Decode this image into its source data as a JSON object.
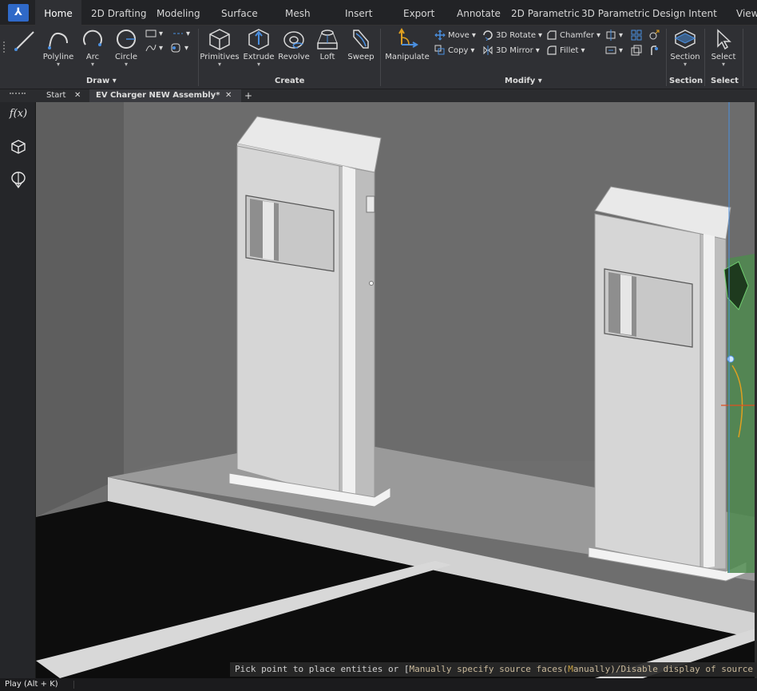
{
  "app": {
    "logo": "⅄"
  },
  "menu": {
    "tabs": [
      "Home",
      "2D Drafting",
      "Modeling",
      "Surface",
      "Mesh",
      "Insert",
      "Export",
      "Annotate",
      "2D Parametric",
      "3D Parametric",
      "Design Intent",
      "View"
    ],
    "active": "Home"
  },
  "ribbon": {
    "draw": {
      "polyline": "Polyline",
      "arc": "Arc",
      "circle": "Circle",
      "group": "Draw"
    },
    "create": {
      "primitives": "Primitives",
      "extrude": "Extrude",
      "revolve": "Revolve",
      "loft": "Loft",
      "sweep": "Sweep",
      "group": "Create"
    },
    "modify": {
      "manipulate": "Manipulate",
      "move": "Move",
      "rotate3d": "3D Rotate",
      "chamfer": "Chamfer",
      "copy": "Copy",
      "mirror3d": "3D Mirror",
      "fillet": "Fillet",
      "group": "Modify"
    },
    "section": {
      "label": "Section",
      "group": "Section"
    },
    "select": {
      "label": "Select",
      "group": "Select"
    }
  },
  "doc_tabs": {
    "start": "Start",
    "active": "EV Charger NEW Assembly*",
    "close": "✕",
    "add": "+"
  },
  "leftbar": {
    "fx": "f(x)"
  },
  "command_line": {
    "prefix": "Pick point to place entities or [",
    "opt1_pre": "M",
    "opt1_rest": "anually specify source faces(",
    "opt1_key": "M",
    "opt1_end": "anually)/",
    "opt2": "Disable display of source"
  },
  "statusbar": {
    "play": "Play (Alt + K)"
  },
  "colors": {
    "accent": "#2f69c8",
    "ribbon_bg": "#2f3034",
    "viewport_bg": "#6e6e6e"
  }
}
